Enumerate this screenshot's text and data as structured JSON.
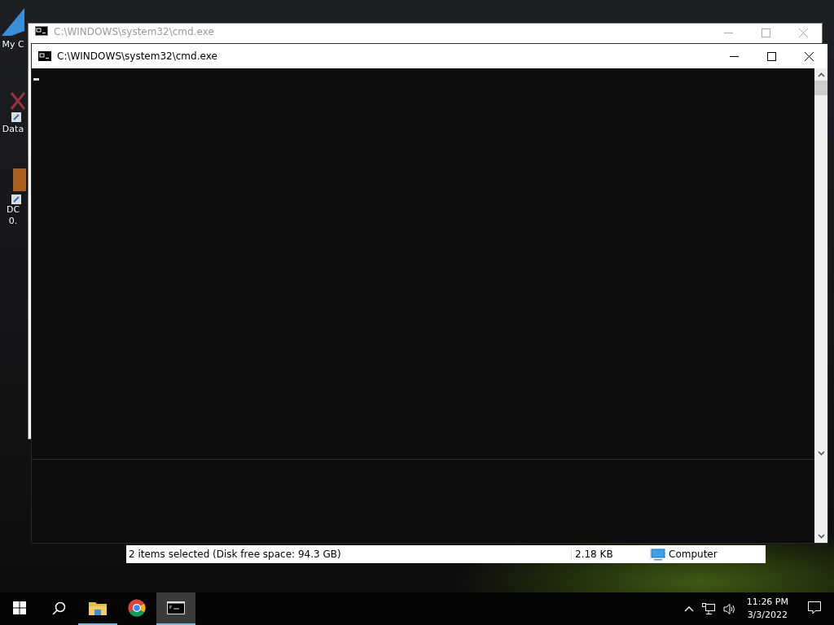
{
  "desktop_icons": [
    {
      "kind": "shortcut-arrow",
      "labels": [
        "My C"
      ]
    },
    {
      "kind": "shortcut-db",
      "labels": [
        "Data"
      ]
    },
    {
      "kind": "shortcut-doc",
      "labels": [
        "DC",
        "0."
      ]
    }
  ],
  "windows": [
    {
      "title": "C:\\WINDOWS\\system32\\cmd.exe",
      "active": false
    },
    {
      "title": "C:\\WINDOWS\\system32\\cmd.exe",
      "active": true
    }
  ],
  "explorer_status_bar": {
    "selection": "2 items selected (Disk free space: 94.3 GB)",
    "size": "2.18 KB",
    "location": "Computer"
  },
  "taskbar": {
    "apps": [
      {
        "kind": "file-explorer",
        "running": true,
        "active": false
      },
      {
        "kind": "browser",
        "running": false,
        "active": false
      },
      {
        "kind": "console",
        "running": true,
        "active": true
      }
    ],
    "clock": {
      "time": "11:26 PM",
      "date": "3/3/2022"
    }
  }
}
